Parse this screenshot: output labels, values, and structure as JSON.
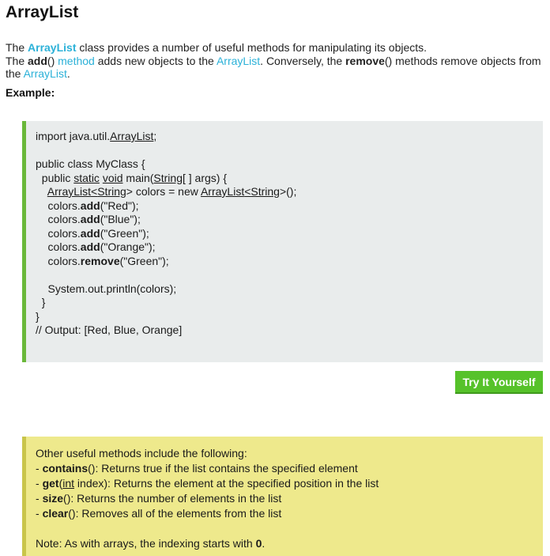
{
  "page": {
    "title": "ArrayList",
    "intro": {
      "p1_a": "The ",
      "p1_kw": "ArrayList",
      "p1_b": " class provides a number of useful methods for manipulating its objects.",
      "p2_a": "The ",
      "p2_add": "add",
      "p2_paren": "() ",
      "p2_method": "method",
      "p2_b": " adds new objects to the ",
      "p2_kw": "ArrayList",
      "p2_c": ". Conversely, the ",
      "p2_remove": "remove",
      "p2_d": "() methods remove objects from the ",
      "p2_kw2": "ArrayList",
      "p2_e": "."
    },
    "example_label": "Example:"
  },
  "code": {
    "l1_a": "import java.util.",
    "l1_u": "ArrayList",
    "l1_b": ";",
    "l2": "public class MyClass {",
    "l3_a": "  public ",
    "l3_static": "static",
    "l3_sp": " ",
    "l3_void": "void",
    "l3_b": " main(",
    "l3_string": "String",
    "l3_c": "[ ] args) {",
    "l4_indent": "    ",
    "l4_al": "ArrayList",
    "l4_lt": "<",
    "l4_str": "String",
    "l4_b": "> colors = new ",
    "l4_al2": "ArrayList",
    "l4_lt2": "<",
    "l4_str2": "String",
    "l4_c": ">();",
    "add_prefix": "    colors.",
    "add_kw": "add",
    "add_red": "(\"Red\");",
    "add_blue": "(\"Blue\");",
    "add_green": "(\"Green\");",
    "add_orange": "(\"Orange\");",
    "remove_kw": "remove",
    "remove_arg": "(\"Green\");",
    "println": "    System.out.println(colors);",
    "close_inner": "  }",
    "close_outer": "}",
    "output": "// Output: [Red, Blue, Orange]"
  },
  "try_button": {
    "label": "Try It Yourself",
    "color": "#56c22a"
  },
  "notes": {
    "header": "Other useful methods include the following:",
    "items": [
      {
        "dash": "- ",
        "name": "contains",
        "rest": "(): Returns true if the list contains the specified element"
      },
      {
        "dash": "- ",
        "name": "get",
        "open": "(",
        "arg": "int",
        "rest": " index): Returns the element at the specified position in the list"
      },
      {
        "dash": "- ",
        "name": "size",
        "rest": "(): Returns the number of elements in the list"
      },
      {
        "dash": "- ",
        "name": "clear",
        "rest": "(): Removes all of the elements from the list"
      }
    ],
    "note_a": "Note: As with arrays, the indexing starts with ",
    "note_b": "0",
    "note_c": "."
  },
  "colors": {
    "accent": "#2bb1d8",
    "code_bg": "#e9ecec",
    "code_border": "#6ab83a",
    "note_bg": "#eee98c",
    "note_border": "#c9c54a"
  }
}
